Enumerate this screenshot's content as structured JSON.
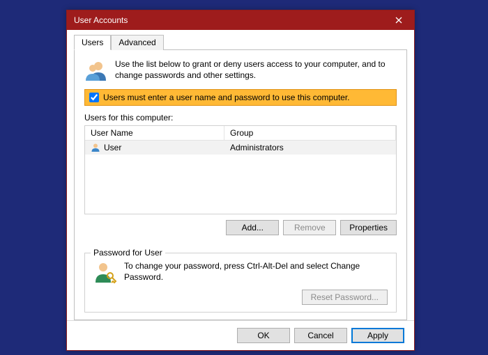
{
  "window": {
    "title": "User Accounts"
  },
  "tabs": [
    {
      "label": "Users"
    },
    {
      "label": "Advanced"
    }
  ],
  "intro": "Use the list below to grant or deny users access to your computer, and to change passwords and other settings.",
  "require_login_checkbox": {
    "checked": true,
    "label": "Users must enter a user name and password to use this computer."
  },
  "users_section_label": "Users for this computer:",
  "listview": {
    "columns": {
      "name": "User Name",
      "group": "Group"
    },
    "rows": [
      {
        "name": "User",
        "group": "Administrators"
      }
    ]
  },
  "buttons": {
    "add": "Add...",
    "remove": "Remove",
    "properties": "Properties"
  },
  "password_group": {
    "legend": "Password for User",
    "text": "To change your password, press Ctrl-Alt-Del and select Change Password.",
    "reset": "Reset Password..."
  },
  "footer": {
    "ok": "OK",
    "cancel": "Cancel",
    "apply": "Apply"
  }
}
